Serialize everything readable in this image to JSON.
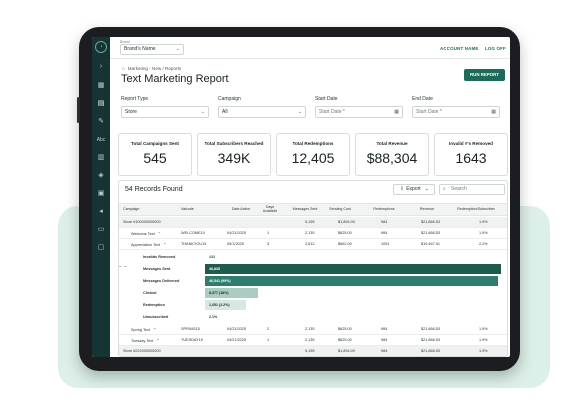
{
  "topbar": {
    "brand_label": "Brand",
    "brand_value": "Brand's Name",
    "account_name": "ACCOUNT NAME",
    "log_off": "LOG OFF"
  },
  "breadcrumb": "Marketing - New  /  Reports",
  "page_title": "Text Marketing Report",
  "run_report": "RUN REPORT",
  "filters": {
    "report_type": {
      "label": "Report Type",
      "value": "Store"
    },
    "campaign": {
      "label": "Campaign",
      "value": "All"
    },
    "start_date": {
      "label": "Start Date",
      "placeholder": "Start Date *"
    },
    "end_date": {
      "label": "End Date",
      "placeholder": "Start Date *"
    }
  },
  "cards": [
    {
      "title": "Total Campaigns Sent",
      "value": "545"
    },
    {
      "title": "Total Subscribers Reached",
      "value": "349K"
    },
    {
      "title": "Total Redemptions",
      "value": "12,405"
    },
    {
      "title": "Total Revenue",
      "value": "$88,304"
    },
    {
      "title": "Invalid #'s Removed",
      "value": "1643"
    }
  ],
  "records": {
    "title": "54 Records Found",
    "export": "Export",
    "search_placeholder": "Search"
  },
  "columns": [
    "Campaign",
    "Valcode",
    "Date Active",
    "Days Available",
    "Messages Sent",
    "Sending Cost",
    "Redemptions",
    "Revenue",
    "Redemption/Subscriber"
  ],
  "rows_top": [
    {
      "campaign": "Store #100000000000",
      "valcode": "",
      "date": "",
      "days": "",
      "sent": "5,195",
      "cost": "$1,894.00",
      "red": "984",
      "rev": "$21,866.53",
      "rps": "1.9%",
      "grey": true
    },
    {
      "campaign": "Welcome Text",
      "valcode": "WELCOME10",
      "date": "04/21/2025",
      "days": "1",
      "sent": "2,135",
      "cost": "$625.00",
      "red": "984",
      "rev": "$21,866.53",
      "rps": "1.9%",
      "grey": false
    },
    {
      "campaign": "Appreciation Text",
      "valcode": "THANKYOU15",
      "date": "05/1/2025",
      "days": "3",
      "sent": "2,612",
      "cost": "$662.00",
      "red": "1051",
      "rev": "$19,467.51",
      "rps": "2.2%",
      "grey": false
    }
  ],
  "funnel": [
    {
      "label": "Invalids Removed",
      "value": "433",
      "fraction": 0,
      "color": "#ffffff",
      "text_color": "#1d6a5a"
    },
    {
      "label": "Messages Sent",
      "value": "46,835",
      "fraction": 1.0,
      "color": "#1f5a4f",
      "text_color": "#ffffff"
    },
    {
      "label": "Messages Delivered",
      "value": "46,541 (99%)",
      "fraction": 0.99,
      "color": "#2f7d6c",
      "text_color": "#ffffff"
    },
    {
      "label": "Clicked",
      "value": "8,377 (18%)",
      "fraction": 0.18,
      "color": "#a9ccc3",
      "text_color": "#1a2222"
    },
    {
      "label": "Redemption",
      "value": "1,051 (2.2%)",
      "fraction": 0.14,
      "color": "#d7e8e3",
      "text_color": "#1a2222"
    },
    {
      "label": "Unsubscribed",
      "value": "2.1%",
      "fraction": 0,
      "color": "#ffffff",
      "text_color": "#1a2222"
    }
  ],
  "rows_bottom": [
    {
      "campaign": "Spring Text",
      "valcode": "SPRING15",
      "date": "04/21/2025",
      "days": "2",
      "sent": "2,135",
      "cost": "$625.00",
      "red": "984",
      "rev": "$21,866.53",
      "rps": "1.9%",
      "grey": false
    },
    {
      "campaign": "Tuesday Text",
      "valcode": "TUESDAY15",
      "date": "04/21/2025",
      "days": "1",
      "sent": "2,135",
      "cost": "$625.00",
      "red": "984",
      "rev": "$21,866.53",
      "rps": "1.9%",
      "grey": false
    },
    {
      "campaign": "Store #222000000000",
      "valcode": "",
      "date": "",
      "days": "",
      "sent": "5,195",
      "cost": "$1,894.00",
      "red": "984",
      "rev": "$21,866.53",
      "rps": "1.9%",
      "grey": true
    }
  ],
  "sidebar_icons": [
    "chevron-right-icon",
    "dashboard-icon",
    "chart-icon",
    "wrench-icon",
    "abc-icon",
    "grid-icon",
    "tag-icon",
    "gift-icon",
    "megaphone-icon",
    "monitor-icon",
    "lock-icon"
  ]
}
